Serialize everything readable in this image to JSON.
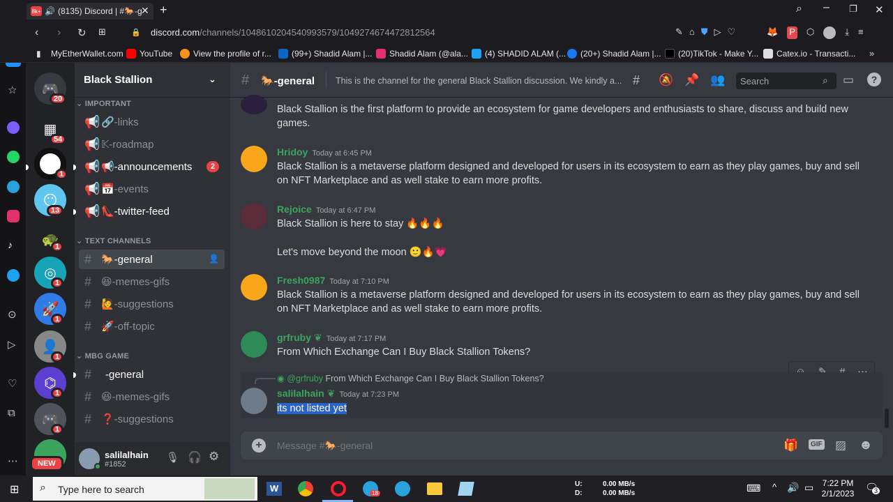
{
  "browser": {
    "tab_title": "(8135) Discord | #🐎-g",
    "url_host": "discord.com",
    "url_path": "/channels/1048610204540993579/1049274674472812564",
    "bookmarks": [
      "MyEtherWallet.com",
      "YouTube",
      "View the profile of r...",
      "(99+) Shadid Alam |...",
      "Shadid Alam (@ala...",
      "(4) SHADID ALAM (...",
      "(20+) Shadid Alam |...",
      "(20)TikTok - Make Y...",
      "Catex.io - Transacti..."
    ]
  },
  "guilds": {
    "badges": [
      "20",
      "54",
      "1",
      "13",
      "1",
      "1",
      "1",
      "1",
      "1",
      "1",
      "1"
    ],
    "new_label": "NEW"
  },
  "server": {
    "name": "Black Stallion",
    "categories": {
      "important": "IMPORTANT",
      "text": "TEXT CHANNELS",
      "mbg": "MBG GAME"
    },
    "channels": {
      "links": "🔗-links",
      "roadmap": "𝕂-roadmap",
      "announcements": "📢-announcements",
      "announcements_badge": "2",
      "events": "📅-events",
      "twitter": "👠-twitter-feed",
      "general": "🐎-general",
      "memes": "😆-memes-gifs",
      "suggestions": "🙋-suggestions",
      "offtopic": "🚀-off-topic",
      "mbg_general": "-general",
      "mbg_memes": "😆-memes-gifs",
      "mbg_suggestions": "❓-suggestions"
    }
  },
  "user": {
    "name": "salilalhain",
    "tag": "#1852"
  },
  "header": {
    "channel": "🐎-general",
    "topic": "This is the channel for the general Black Stallion discussion. We kindly a...",
    "search_placeholder": "Search"
  },
  "messages": [
    {
      "author": "",
      "time": "",
      "text": "Black Stallion is the first platform to provide an ecosystem for game developers and enthusiasts to share, discuss and build new games."
    },
    {
      "author": "Hridoy",
      "time": "Today at 6:45 PM",
      "text": "Black Stallion is a metaverse platform designed and developed for users in its ecosystem to earn as they play games, buy and sell on NFT Marketplace and as well stake to earn more profits."
    },
    {
      "author": "Rejoice",
      "time": "Today at 6:47 PM",
      "text": "Black Stallion is here to stay 🔥🔥🔥",
      "text2": "Let's move beyond the moon 🙂🔥💗"
    },
    {
      "author": "Fresh0987",
      "time": "Today at 7:10 PM",
      "text": "Black Stallion is a metaverse platform designed and developed for users in its ecosystem to earn as they play games, buy and sell on NFT Marketplace and as well stake to earn more profits."
    },
    {
      "author": "grfruby",
      "time": "Today at 7:17 PM",
      "text": "From Which Exchange Can I Buy Black Stallion Tokens?"
    },
    {
      "author": "salilalhain",
      "time": "Today at 7:23 PM",
      "reply_to": "@grfruby",
      "reply_text": "From Which Exchange Can I Buy Black Stallion Tokens?",
      "text": "its not listed yet"
    }
  ],
  "composer": {
    "placeholder": "Message #🐎-general",
    "gif": "GIF"
  },
  "taskbar": {
    "search_placeholder": "Type here to search",
    "net_u_label": "U:",
    "net_d_label": "D:",
    "net_u": "0.00 MB/s",
    "net_d": "0.00 MB/s",
    "time": "7:22 PM",
    "date": "2/1/2023",
    "notif_count": "3",
    "telegram_badge": "18"
  },
  "colors": {
    "accent": "#5865f2",
    "green": "#3ba55d",
    "red": "#ed4245",
    "user_green": "#43b581"
  }
}
